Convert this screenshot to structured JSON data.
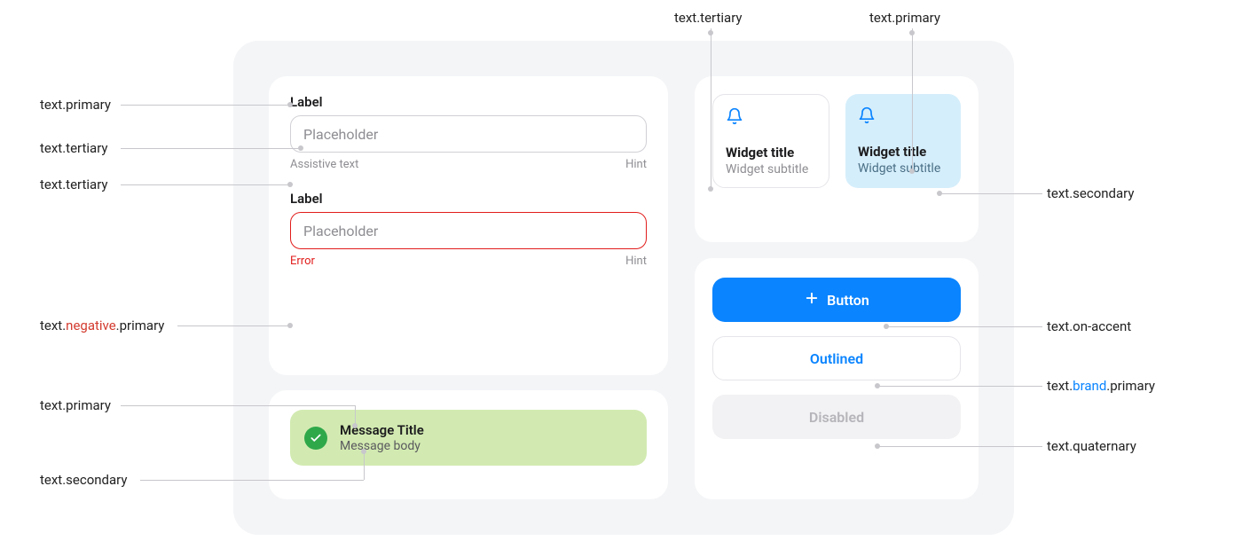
{
  "annotations": {
    "left_text_primary": "text.primary",
    "left_text_tertiary_1": "text.tertiary",
    "left_text_tertiary_2": "text.tertiary",
    "left_text_negative_pre": "text.",
    "left_text_negative_mid": "negative",
    "left_text_negative_post": ".primary",
    "left_text_primary_2": "text.primary",
    "left_text_secondary": "text.secondary",
    "top_text_tertiary": "text.tertiary",
    "top_text_primary": "text.primary",
    "right_text_secondary": "text.secondary",
    "right_text_on_accent": "text.on-accent",
    "right_text_brand_pre": "text.",
    "right_text_brand_mid": "brand",
    "right_text_brand_post": ".primary",
    "right_text_quaternary": "text.quaternary"
  },
  "form1": {
    "label": "Label",
    "placeholder": "Placeholder",
    "assist": "Assistive text",
    "hint": "Hint"
  },
  "form2": {
    "label": "Label",
    "placeholder": "Placeholder",
    "error": "Error",
    "hint": "Hint"
  },
  "message": {
    "title": "Message Title",
    "body": "Message body"
  },
  "widgets": {
    "a": {
      "title": "Widget title",
      "subtitle": "Widget subtitle"
    },
    "b": {
      "title": "Widget title",
      "subtitle": "Widget subtitle"
    }
  },
  "buttons": {
    "primary": "Button",
    "outlined": "Outlined",
    "disabled": "Disabled"
  }
}
